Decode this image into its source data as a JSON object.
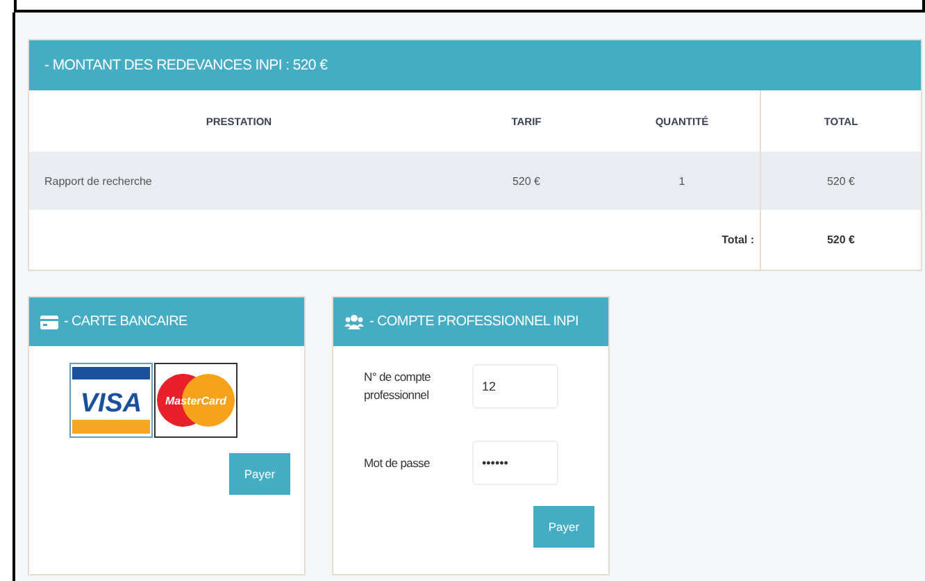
{
  "fees": {
    "title": "- MONTANT DES REDEVANCES INPI : 520 €",
    "columns": [
      "PRESTATION",
      "TARIF",
      "QUANTITÉ",
      "TOTAL"
    ],
    "rows": [
      [
        "Rapport de recherche",
        "520 €",
        "1",
        "520 €"
      ]
    ],
    "total_label": "Total :",
    "total_value": "520 €"
  },
  "cards": [
    {
      "kind": "card",
      "title": "- CARTE BANCAIRE",
      "logos": [
        {
          "kind": "visa",
          "text": "VISA"
        },
        {
          "kind": "mastercard",
          "text": "MasterCard"
        }
      ],
      "button": "Payer"
    },
    {
      "kind": "account",
      "title": "- COMPTE PROFESSIONNEL INPI",
      "fields": [
        {
          "label": "N° de compte professionnel",
          "value": "12"
        },
        {
          "label": "Mot de passe",
          "value": "••••••"
        }
      ],
      "button": "Payer"
    }
  ]
}
